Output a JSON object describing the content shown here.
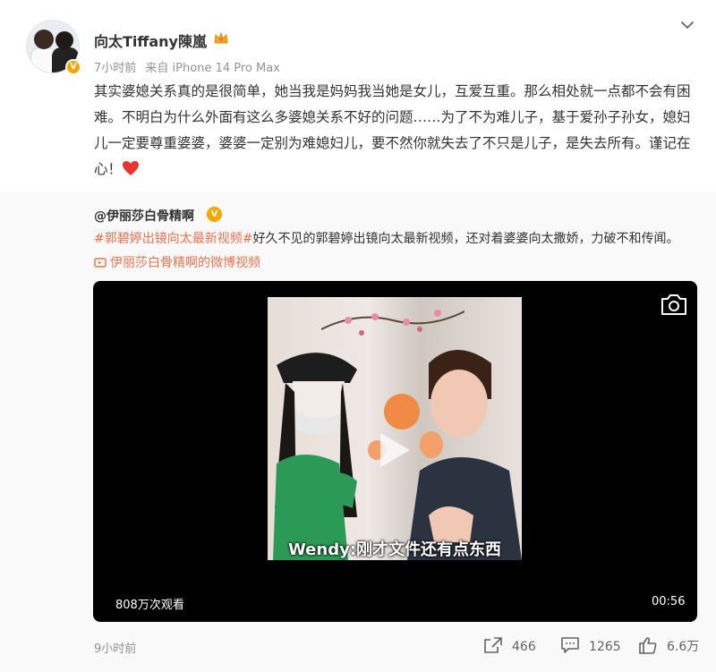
{
  "post": {
    "username": "向太Tiffany陳嵐",
    "time": "7小时前",
    "source": "来自 iPhone 14 Pro Max",
    "text": "其实婆媳关系真的是很简单，她当我是妈妈我当她是女儿，互爱互重。那么相处就一点都不会有困难。不明白为什么外面有这么多婆媳关系不好的问题……为了不为难儿子，基于爱孙子孙女，媳妇儿一定要尊重婆婆，婆婆一定别为难媳妇儿，要不然你就失去了不只是儿子，是失去所有。谨记在心！",
    "verified_mark": "V",
    "icons": [
      "crown-icon",
      "chevron-down-icon",
      "heart-icon"
    ]
  },
  "repost": {
    "username": "@伊丽莎白骨精啊",
    "verified_mark": "V",
    "hashtag": "#郭碧婷出镜向太最新视频#",
    "text": "好久不见的郭碧婷出镜向太最新视频，还对着婆婆向太撒娇，力破不和传闻。",
    "video_link": "伊丽莎白骨精啊的微博视频",
    "time": "9小时前"
  },
  "video": {
    "caption": "Wendy:刚才文件还有点东西",
    "views": "808万次观看",
    "duration": "00:56"
  },
  "stats": {
    "reposts": "466",
    "comments": "1265",
    "likes": "6.6万"
  },
  "colors": {
    "accent_link": "#eb7350",
    "verified": "#f7a600",
    "heart": "#e8342c"
  }
}
